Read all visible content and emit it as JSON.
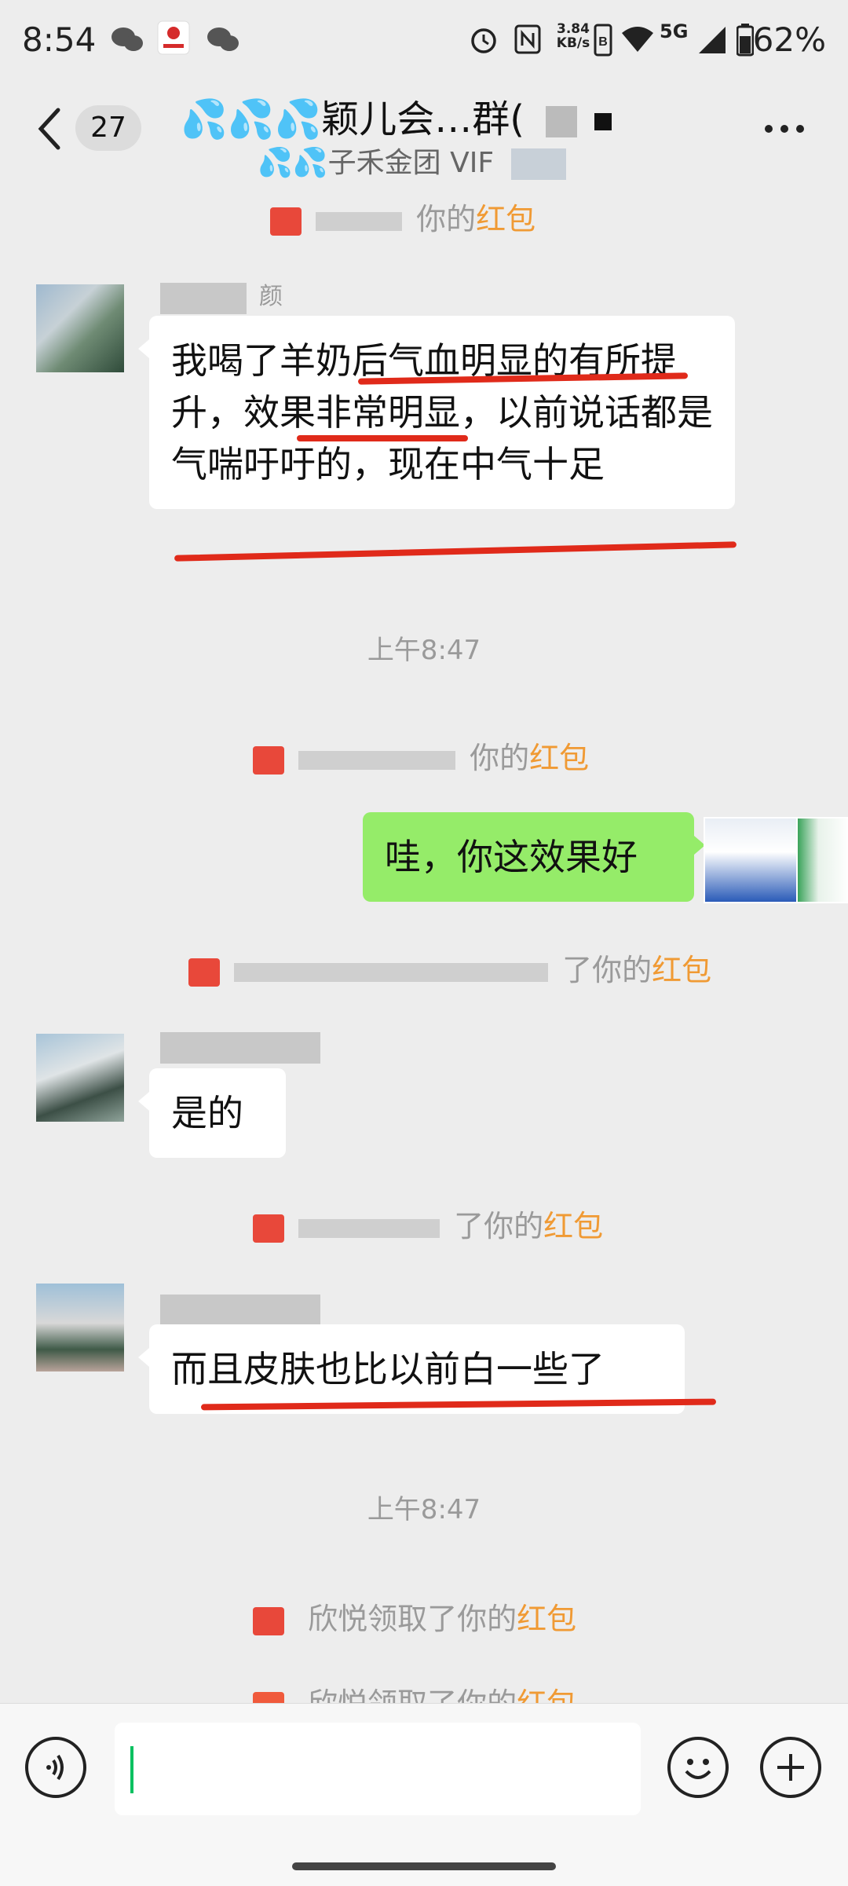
{
  "status": {
    "time": "8:54",
    "net_speed_value": "3.84",
    "net_speed_unit": "KB/s",
    "network": "5G",
    "battery": "62%"
  },
  "header": {
    "unread_count": "27",
    "title": "💦💦💦颖儿会…群(",
    "subtitle": "💦💦子禾金团 VIF"
  },
  "messages": {
    "sys1_text": "你的",
    "sys1_hl": "红包",
    "sender1_name_fragment": "颜",
    "msg1": "我喝了羊奶后气血明显的有所提升，效果非常明显，以前说话都是气喘吁吁的，现在中气十足",
    "time1": "上午8:47",
    "sys2_text": "你的",
    "sys2_hl": "红包",
    "my_msg": "哇，你这效果好",
    "sys3_text": "了你的",
    "sys3_hl": "红包",
    "msg2": "是的",
    "sys4_text": "了你的",
    "sys4_hl": "红包",
    "msg3": "而且皮肤也比以前白一些了",
    "time2": "上午8:47",
    "sys5_text": "欣悦领取了你的",
    "sys5_hl": "红包",
    "sys6_text": "欣悦领取了你的",
    "sys6_hl": "红包"
  },
  "icons": {
    "back": "chevron-left-icon",
    "more": "more-dots-icon",
    "voice": "voice-icon",
    "emoji": "emoji-icon",
    "plus": "plus-icon"
  },
  "colors": {
    "my_bubble": "#95ec69",
    "red_packet": "#e8483a",
    "highlight": "#f09a34",
    "underline": "#e02a1a"
  }
}
